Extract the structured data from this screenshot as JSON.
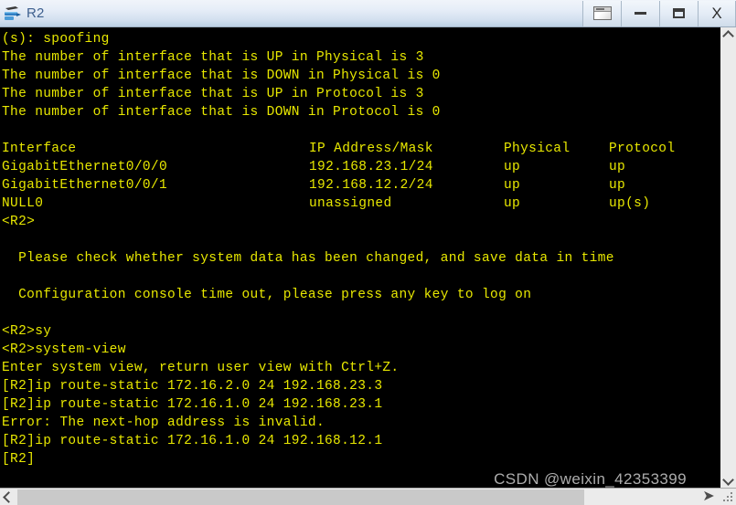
{
  "window": {
    "title": "R2",
    "icon": "router-device-icon",
    "accent_color": "#3d5f8e",
    "titlebar_bg": "#e7eef8"
  },
  "titlebar_buttons": [
    {
      "name": "restore-button",
      "label": "",
      "glyph": "restore-icon"
    },
    {
      "name": "minimize-button",
      "label": "",
      "glyph": "minimize-icon"
    },
    {
      "name": "maximize-button",
      "label": "",
      "glyph": "maximize-icon"
    },
    {
      "name": "close-button",
      "label": "X",
      "glyph": "close-icon"
    }
  ],
  "terminal": {
    "foreground_color": "#e8e800",
    "background_color": "#000000",
    "lines": [
      "(s): spoofing",
      "The number of interface that is UP in Physical is 3",
      "The number of interface that is DOWN in Physical is 0",
      "The number of interface that is UP in Protocol is 3",
      "The number of interface that is DOWN in Protocol is 0",
      "",
      "__TABLE__",
      "<R2>",
      "",
      "  Please check whether system data has been changed, and save data in time",
      "",
      "  Configuration console time out, please press any key to log on",
      "",
      "<R2>sy",
      "<R2>system-view",
      "Enter system view, return user view with Ctrl+Z.",
      "[R2]ip route-static 172.16.2.0 24 192.168.23.3",
      "[R2]ip route-static 172.16.1.0 24 192.168.23.1",
      "Error: The next-hop address is invalid.",
      "[R2]ip route-static 172.16.1.0 24 192.168.12.1",
      "[R2]"
    ],
    "interface_table": {
      "columns": [
        "Interface",
        "IP Address/Mask",
        "Physical",
        "Protocol"
      ],
      "rows": [
        {
          "interface": "GigabitEthernet0/0/0",
          "ip": "192.168.23.1/24",
          "physical": "up",
          "protocol": "up"
        },
        {
          "interface": "GigabitEthernet0/0/1",
          "ip": "192.168.12.2/24",
          "physical": "up",
          "protocol": "up"
        },
        {
          "interface": "NULL0",
          "ip": "unassigned",
          "physical": "up",
          "protocol": "up(s)"
        }
      ]
    },
    "interface_counts": {
      "up_in_physical": 3,
      "down_in_physical": 0,
      "up_in_protocol": 3,
      "down_in_protocol": 0
    }
  },
  "scrollbars": {
    "vertical": {
      "up_icon": "chevron-up-icon",
      "down_icon": "chevron-down-icon"
    },
    "horizontal": {
      "left_icon": "chevron-left-icon",
      "right_icon": "arrow-right-icon"
    },
    "resize_grip_icon": "resize-grip-icon"
  },
  "watermark": {
    "text": "CSDN @weixin_42353399"
  }
}
